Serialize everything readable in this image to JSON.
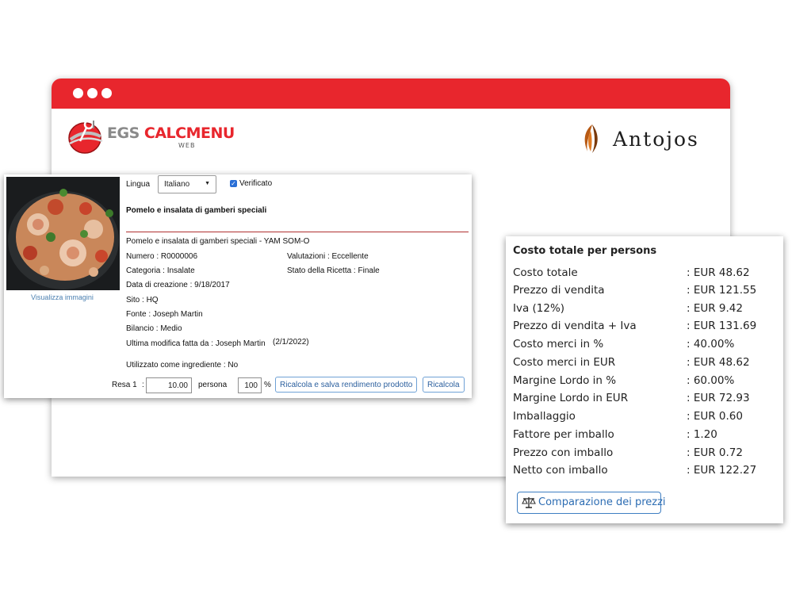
{
  "brand": {
    "egs_left": "EGS",
    "egs_right": "CALCMENU",
    "egs_sub": "WEB",
    "partner": "Antojos"
  },
  "recipe": {
    "language_label": "Lingua",
    "language_value": "Italiano",
    "verified_label": "Verificato",
    "verified": true,
    "title": "Pomelo e insalata di gamberi speciali",
    "view_images": "Visualizza immagini",
    "subtitle": "Pomelo e insalata di gamberi speciali - YAM SOM-O",
    "numero": "Numero : R0000006",
    "valutazioni": "Valutazioni : Eccellente",
    "categoria": "Categoria : Insalate",
    "stato": "Stato della Ricetta : Finale",
    "data_creazione": "Data di creazione : 9/18/2017",
    "sito": "Sito : HQ",
    "fonte": "Fonte : Joseph Martin",
    "bilancio": "Bilancio : Medio",
    "ultima_modifica": "Ultima modifica fatta da : Joseph Martin",
    "ultima_modifica_date": "(2/1/2022)",
    "utilizzato": "Utilizzato come ingrediente : No",
    "resa_label": "Resa 1",
    "resa_colon": ":",
    "resa_value": "10.00",
    "persona_label": "persona",
    "percent_value": "100",
    "percent_sign": "%",
    "btn_save": "Ricalcola e salva rendimento prodotto",
    "btn_recalc": "Ricalcola"
  },
  "cost": {
    "title": "Costo totale per persons",
    "rows": [
      {
        "label": "Costo totale",
        "value": ": EUR 48.62"
      },
      {
        "label": "Prezzo di vendita",
        "value": ": EUR 121.55"
      },
      {
        "label": "Iva (12%)",
        "value": ": EUR 9.42"
      },
      {
        "label": "Prezzo di vendita + Iva",
        "value": ": EUR 131.69"
      },
      {
        "label": "Costo merci in %",
        "value": ": 40.00%"
      },
      {
        "label": "Costo merci in EUR",
        "value": ": EUR 48.62"
      },
      {
        "label": "Margine Lordo in %",
        "value": ": 60.00%"
      },
      {
        "label": "Margine Lordo in  EUR",
        "value": ": EUR 72.93"
      },
      {
        "label": "Imballaggio",
        "value": ": EUR 0.60"
      },
      {
        "label": "Fattore per imballo",
        "value": ": 1.20"
      },
      {
        "label": "Prezzo con imballo",
        "value": ": EUR 0.72"
      },
      {
        "label": "Netto con imballo",
        "value": ": EUR 122.27"
      }
    ],
    "compare_button": "Comparazione dei prezzi",
    "compare_icon": "scale-icon"
  },
  "colors": {
    "accent": "#e8262d",
    "link": "#2d6db3"
  }
}
